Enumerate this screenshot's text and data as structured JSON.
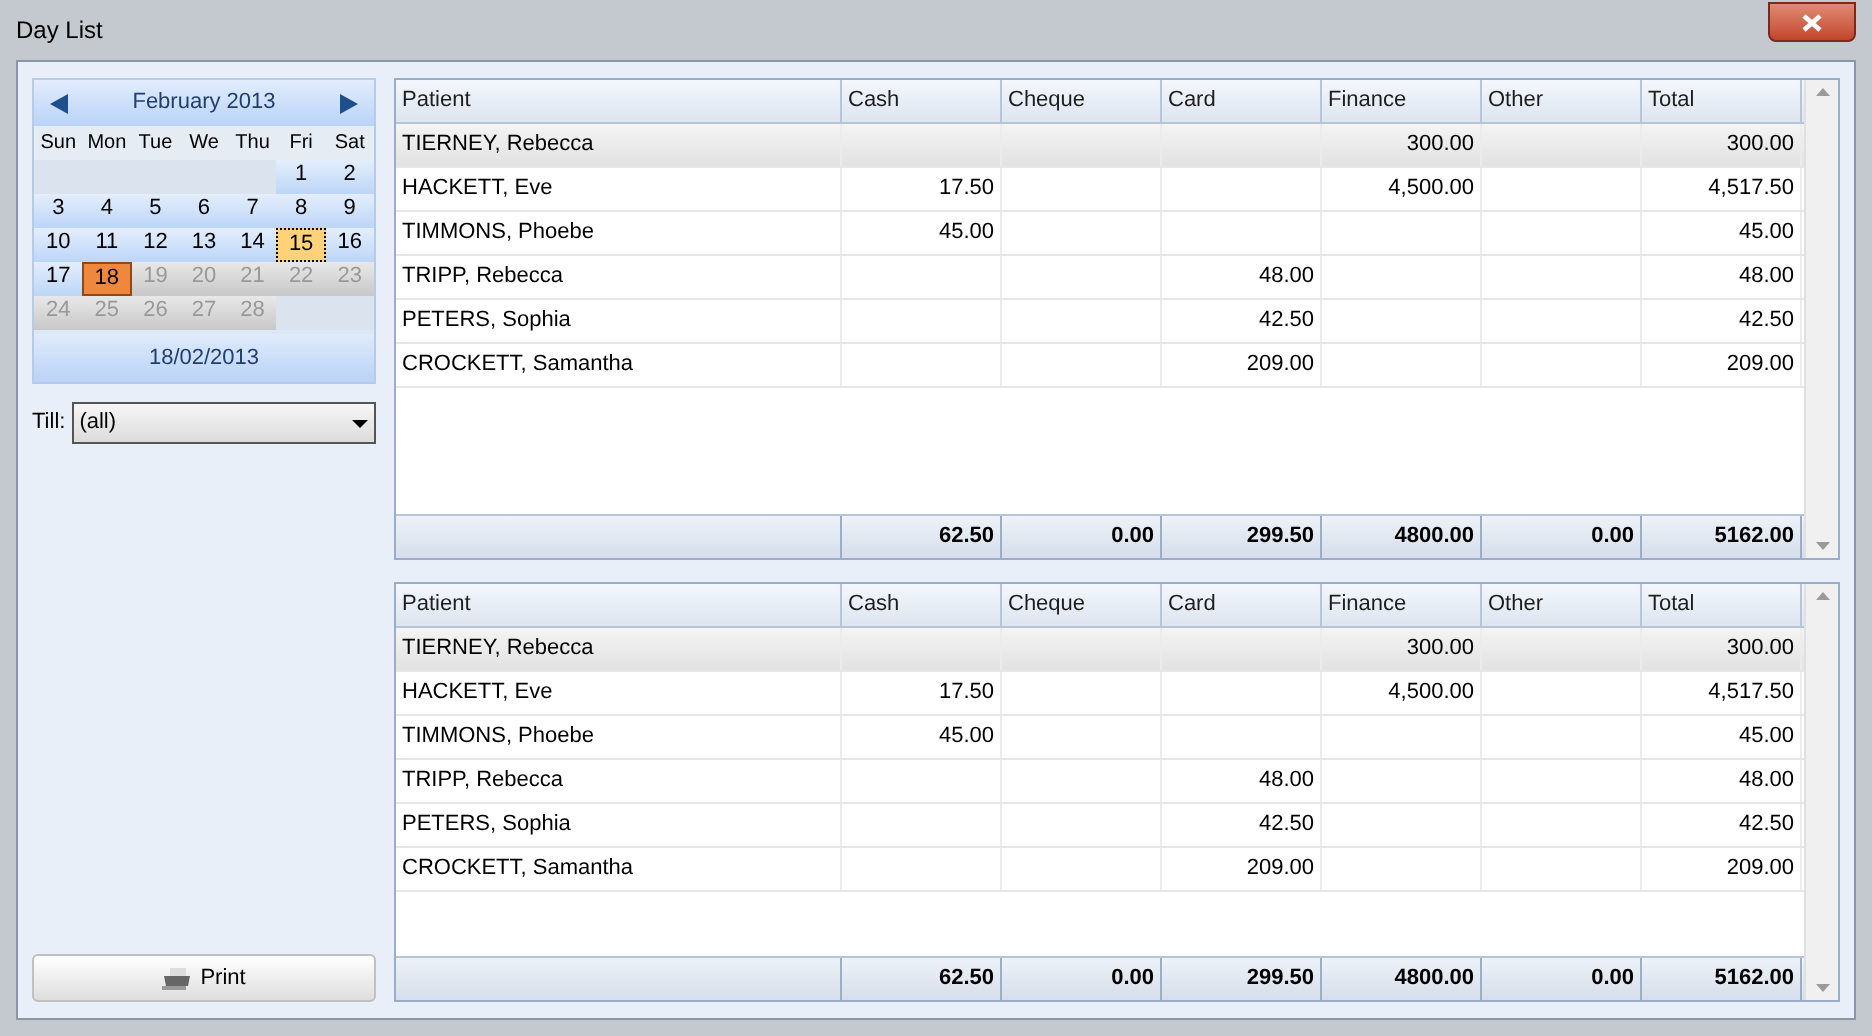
{
  "window": {
    "title": "Day List"
  },
  "calendar": {
    "month": "February 2013",
    "weekdays": [
      "Sun",
      "Mon",
      "Tue",
      "We",
      "Thu",
      "Fri",
      "Sat"
    ],
    "weeks": [
      [
        {
          "kind": "blank"
        },
        {
          "kind": "blank"
        },
        {
          "kind": "blank"
        },
        {
          "kind": "blank"
        },
        {
          "kind": "blank"
        },
        {
          "kind": "day",
          "label": "1",
          "selected": false,
          "today": false,
          "muted": false
        },
        {
          "kind": "day",
          "label": "2",
          "selected": false,
          "today": false,
          "muted": false
        }
      ],
      [
        {
          "kind": "day",
          "label": "3",
          "selected": false,
          "today": false,
          "muted": false
        },
        {
          "kind": "day",
          "label": "4",
          "selected": false,
          "today": false,
          "muted": false
        },
        {
          "kind": "day",
          "label": "5",
          "selected": false,
          "today": false,
          "muted": false
        },
        {
          "kind": "day",
          "label": "6",
          "selected": false,
          "today": false,
          "muted": false
        },
        {
          "kind": "day",
          "label": "7",
          "selected": false,
          "today": false,
          "muted": false
        },
        {
          "kind": "day",
          "label": "8",
          "selected": false,
          "today": false,
          "muted": false
        },
        {
          "kind": "day",
          "label": "9",
          "selected": false,
          "today": false,
          "muted": false
        }
      ],
      [
        {
          "kind": "day",
          "label": "10",
          "selected": false,
          "today": false,
          "muted": false
        },
        {
          "kind": "day",
          "label": "11",
          "selected": false,
          "today": false,
          "muted": false
        },
        {
          "kind": "day",
          "label": "12",
          "selected": false,
          "today": false,
          "muted": false
        },
        {
          "kind": "day",
          "label": "13",
          "selected": false,
          "today": false,
          "muted": false
        },
        {
          "kind": "day",
          "label": "14",
          "selected": false,
          "today": false,
          "muted": false
        },
        {
          "kind": "day",
          "label": "15",
          "selected": false,
          "today": true,
          "muted": false
        },
        {
          "kind": "day",
          "label": "16",
          "selected": false,
          "today": false,
          "muted": false
        }
      ],
      [
        {
          "kind": "day",
          "label": "17",
          "selected": false,
          "today": false,
          "muted": false
        },
        {
          "kind": "day",
          "label": "18",
          "selected": true,
          "today": false,
          "muted": false
        },
        {
          "kind": "day",
          "label": "19",
          "selected": false,
          "today": false,
          "muted": true
        },
        {
          "kind": "day",
          "label": "20",
          "selected": false,
          "today": false,
          "muted": true
        },
        {
          "kind": "day",
          "label": "21",
          "selected": false,
          "today": false,
          "muted": true
        },
        {
          "kind": "day",
          "label": "22",
          "selected": false,
          "today": false,
          "muted": true
        },
        {
          "kind": "day",
          "label": "23",
          "selected": false,
          "today": false,
          "muted": true
        }
      ],
      [
        {
          "kind": "day",
          "label": "24",
          "selected": false,
          "today": false,
          "muted": true
        },
        {
          "kind": "day",
          "label": "25",
          "selected": false,
          "today": false,
          "muted": true
        },
        {
          "kind": "day",
          "label": "26",
          "selected": false,
          "today": false,
          "muted": true
        },
        {
          "kind": "day",
          "label": "27",
          "selected": false,
          "today": false,
          "muted": true
        },
        {
          "kind": "day",
          "label": "28",
          "selected": false,
          "today": false,
          "muted": true
        },
        {
          "kind": "blank"
        },
        {
          "kind": "blank"
        }
      ]
    ],
    "date": "18/02/2013"
  },
  "till": {
    "label": "Till:",
    "value": "(all)"
  },
  "print_button": "Print",
  "grids": [
    {
      "columns": [
        "Patient",
        "Cash",
        "Cheque",
        "Card",
        "Finance",
        "Other",
        "Total"
      ],
      "rows": [
        {
          "selected": true,
          "cells": [
            "TIERNEY, Rebecca",
            "",
            "",
            "",
            "300.00",
            "",
            "300.00"
          ]
        },
        {
          "selected": false,
          "cells": [
            "HACKETT, Eve",
            "17.50",
            "",
            "",
            "4,500.00",
            "",
            "4,517.50"
          ]
        },
        {
          "selected": false,
          "cells": [
            "TIMMONS, Phoebe",
            "45.00",
            "",
            "",
            "",
            "",
            "45.00"
          ]
        },
        {
          "selected": false,
          "cells": [
            "TRIPP, Rebecca",
            "",
            "",
            "48.00",
            "",
            "",
            "48.00"
          ]
        },
        {
          "selected": false,
          "cells": [
            "PETERS, Sophia",
            "",
            "",
            "42.50",
            "",
            "",
            "42.50"
          ]
        },
        {
          "selected": false,
          "cells": [
            "CROCKETT, Samantha",
            "",
            "",
            "209.00",
            "",
            "",
            "209.00"
          ]
        }
      ],
      "totals": [
        "62.50",
        "0.00",
        "299.50",
        "4800.00",
        "0.00",
        "5162.00"
      ]
    },
    {
      "columns": [
        "Patient",
        "Cash",
        "Cheque",
        "Card",
        "Finance",
        "Other",
        "Total"
      ],
      "rows": [
        {
          "selected": true,
          "cells": [
            "TIERNEY, Rebecca",
            "",
            "",
            "",
            "300.00",
            "",
            "300.00"
          ]
        },
        {
          "selected": false,
          "cells": [
            "HACKETT, Eve",
            "17.50",
            "",
            "",
            "4,500.00",
            "",
            "4,517.50"
          ]
        },
        {
          "selected": false,
          "cells": [
            "TIMMONS, Phoebe",
            "45.00",
            "",
            "",
            "",
            "",
            "45.00"
          ]
        },
        {
          "selected": false,
          "cells": [
            "TRIPP, Rebecca",
            "",
            "",
            "48.00",
            "",
            "",
            "48.00"
          ]
        },
        {
          "selected": false,
          "cells": [
            "PETERS, Sophia",
            "",
            "",
            "42.50",
            "",
            "",
            "42.50"
          ]
        },
        {
          "selected": false,
          "cells": [
            "CROCKETT, Samantha",
            "",
            "",
            "209.00",
            "",
            "",
            "209.00"
          ]
        }
      ],
      "totals": [
        "62.50",
        "0.00",
        "299.50",
        "4800.00",
        "0.00",
        "5162.00"
      ]
    }
  ]
}
